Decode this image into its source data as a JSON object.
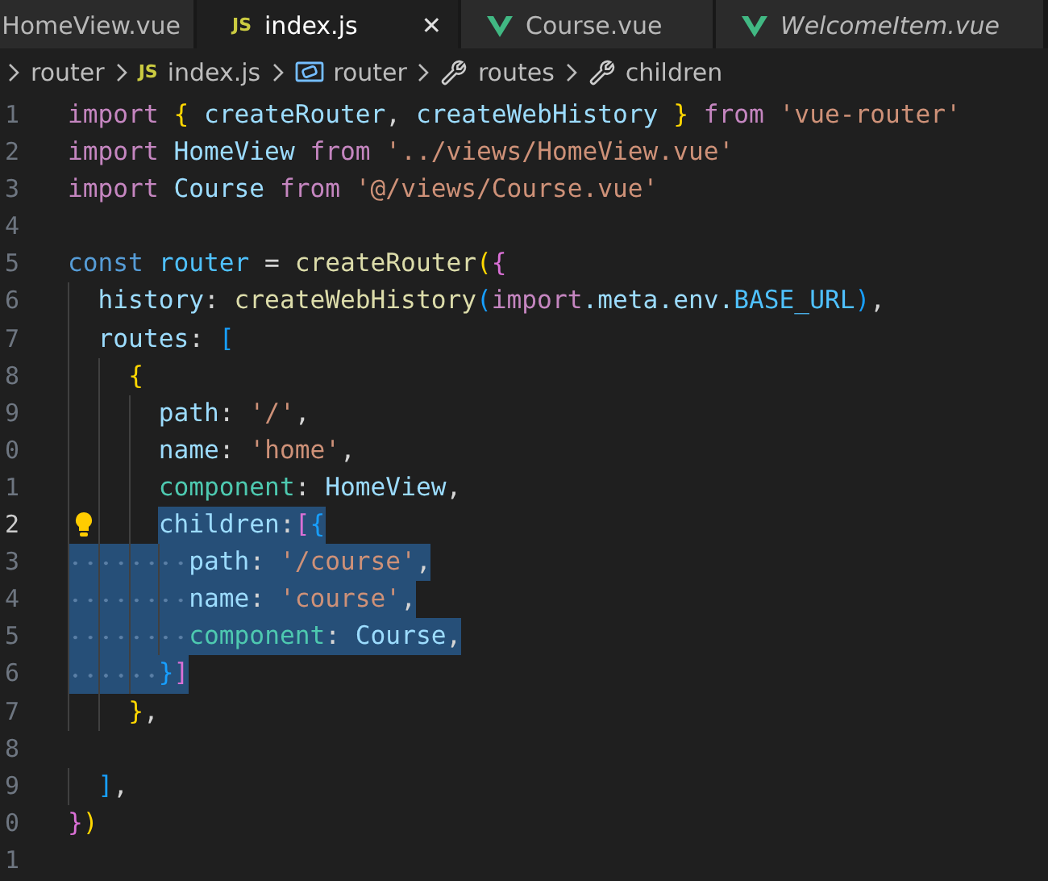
{
  "tabs": [
    {
      "label": "HomeView.vue",
      "selected": false,
      "preview": false,
      "kind": "plain"
    },
    {
      "label": "index.js",
      "selected": true,
      "preview": false,
      "kind": "js",
      "badge": "JS",
      "close": "✕"
    },
    {
      "label": "Course.vue",
      "selected": false,
      "preview": false,
      "kind": "vue"
    },
    {
      "label": "WelcomeItem.vue",
      "selected": false,
      "preview": true,
      "kind": "vue"
    }
  ],
  "breadcrumbs": [
    {
      "label": "router",
      "kind": "folder"
    },
    {
      "label": "index.js",
      "kind": "js",
      "badge": "JS"
    },
    {
      "label": "router",
      "kind": "variable"
    },
    {
      "label": "routes",
      "kind": "property"
    },
    {
      "label": "children",
      "kind": "property"
    }
  ],
  "lines": [
    {
      "number": "1",
      "current": false,
      "lightbulb": false,
      "selected": false,
      "tokens": [
        {
          "t": "import ",
          "kind": "kw"
        },
        {
          "t": "{",
          "kind": "b1"
        },
        {
          "t": " createRouter",
          "kind": "var"
        },
        {
          "t": ", ",
          "kind": "plain"
        },
        {
          "t": "createWebHistory ",
          "kind": "var"
        },
        {
          "t": "}",
          "kind": "b1"
        },
        {
          "t": " from",
          "kind": "kw"
        },
        {
          "t": " 'vue-router'",
          "kind": "str"
        }
      ]
    },
    {
      "number": "2",
      "current": false,
      "lightbulb": false,
      "selected": false,
      "tokens": [
        {
          "t": "import",
          "kind": "kw"
        },
        {
          "t": " HomeView ",
          "kind": "var"
        },
        {
          "t": "from",
          "kind": "kw"
        },
        {
          "t": " '../views/HomeView.vue'",
          "kind": "str"
        }
      ]
    },
    {
      "number": "3",
      "current": false,
      "lightbulb": false,
      "selected": false,
      "tokens": [
        {
          "t": "import",
          "kind": "kw"
        },
        {
          "t": " Course ",
          "kind": "var"
        },
        {
          "t": "from",
          "kind": "kw"
        },
        {
          "t": " '@/views/Course.vue'",
          "kind": "str"
        }
      ]
    },
    {
      "number": "4",
      "current": false,
      "lightbulb": false
    },
    {
      "number": "5",
      "current": false,
      "lightbulb": false,
      "selected": false,
      "tokens": [
        {
          "t": "const",
          "kind": "storage"
        },
        {
          "t": " router",
          "kind": "const"
        },
        {
          "t": " = ",
          "kind": "plain"
        },
        {
          "t": "createRouter",
          "kind": "fn"
        },
        {
          "t": "(",
          "kind": "b1"
        },
        {
          "t": "{",
          "kind": "b2"
        }
      ]
    },
    {
      "number": "6",
      "current": false,
      "lightbulb": false,
      "selected": false,
      "indent_selected": false,
      "tokens": [
        {
          "t": "  history",
          "kind": "prop"
        },
        {
          "t": ": ",
          "kind": "plain"
        },
        {
          "t": "createWebHistory",
          "kind": "fn"
        },
        {
          "t": "(",
          "kind": "b3"
        },
        {
          "t": "import",
          "kind": "kw"
        },
        {
          "t": ".meta.env.",
          "kind": "prop"
        },
        {
          "t": "BASE_URL",
          "kind": "const"
        },
        {
          "t": ")",
          "kind": "b3"
        },
        {
          "t": ",",
          "kind": "plain"
        }
      ]
    },
    {
      "number": "7",
      "current": false,
      "lightbulb": false,
      "selected": false,
      "indent_selected": false,
      "tokens": [
        {
          "t": "  routes",
          "kind": "prop"
        },
        {
          "t": ": ",
          "kind": "plain"
        },
        {
          "t": "[",
          "kind": "b3"
        }
      ]
    },
    {
      "number": "8",
      "current": false,
      "lightbulb": false,
      "selected": false,
      "indent_selected": false,
      "tokens": [
        {
          "t": "    {",
          "kind": "b1"
        }
      ]
    },
    {
      "number": "9",
      "current": false,
      "lightbulb": false,
      "selected": false,
      "indent_selected": false,
      "tokens": [
        {
          "t": "      path",
          "kind": "prop"
        },
        {
          "t": ": ",
          "kind": "plain"
        },
        {
          "t": "'/'",
          "kind": "str"
        },
        {
          "t": ",",
          "kind": "plain"
        }
      ]
    },
    {
      "number": "0",
      "current": false,
      "lightbulb": false,
      "selected": false,
      "indent_selected": false,
      "tokens": [
        {
          "t": "      name",
          "kind": "prop"
        },
        {
          "t": ": ",
          "kind": "plain"
        },
        {
          "t": "'home'",
          "kind": "str"
        },
        {
          "t": ",",
          "kind": "plain"
        }
      ]
    },
    {
      "number": "1",
      "current": false,
      "lightbulb": false,
      "selected": false,
      "indent_selected": false,
      "tokens": [
        {
          "t": "      component",
          "kind": "type"
        },
        {
          "t": ": ",
          "kind": "plain"
        },
        {
          "t": "HomeView",
          "kind": "var"
        },
        {
          "t": ",",
          "kind": "plain"
        }
      ]
    },
    {
      "number": "2",
      "current": true,
      "lightbulb": true,
      "selected": true,
      "indent_selected": false,
      "tokens": [
        {
          "t": "      children",
          "kind": "prop"
        },
        {
          "t": ":",
          "kind": "plain"
        },
        {
          "t": "[",
          "kind": "b2"
        },
        {
          "t": "{",
          "kind": "b3"
        }
      ]
    },
    {
      "number": "3",
      "current": false,
      "lightbulb": false,
      "selected": true,
      "indent_selected": true,
      "tokens": [
        {
          "t": "        path",
          "kind": "prop"
        },
        {
          "t": ": ",
          "kind": "plain"
        },
        {
          "t": "'/course'",
          "kind": "str"
        },
        {
          "t": ",",
          "kind": "plain"
        }
      ]
    },
    {
      "number": "4",
      "current": false,
      "lightbulb": false,
      "selected": true,
      "indent_selected": true,
      "tokens": [
        {
          "t": "        name",
          "kind": "prop"
        },
        {
          "t": ": ",
          "kind": "plain"
        },
        {
          "t": "'course'",
          "kind": "str"
        },
        {
          "t": ",",
          "kind": "plain"
        }
      ]
    },
    {
      "number": "5",
      "current": false,
      "lightbulb": false,
      "selected": true,
      "indent_selected": true,
      "tokens": [
        {
          "t": "        component",
          "kind": "type"
        },
        {
          "t": ": ",
          "kind": "plain"
        },
        {
          "t": "Course",
          "kind": "var"
        },
        {
          "t": ",",
          "kind": "plain"
        }
      ]
    },
    {
      "number": "6",
      "current": false,
      "lightbulb": false,
      "selected": true,
      "indent_selected": true,
      "tokens": [
        {
          "t": "      }",
          "kind": "b3"
        },
        {
          "t": "]",
          "kind": "b2"
        }
      ]
    },
    {
      "number": "7",
      "current": false,
      "lightbulb": false,
      "selected": false,
      "indent_selected": false,
      "tokens": [
        {
          "t": "    }",
          "kind": "b1"
        },
        {
          "t": ",",
          "kind": "plain"
        }
      ]
    },
    {
      "number": "8",
      "current": false,
      "lightbulb": false
    },
    {
      "number": "9",
      "current": false,
      "lightbulb": false,
      "selected": false,
      "indent_selected": false,
      "tokens": [
        {
          "t": "  ]",
          "kind": "b3"
        },
        {
          "t": ",",
          "kind": "plain"
        }
      ]
    },
    {
      "number": "0",
      "current": false,
      "lightbulb": false,
      "selected": false,
      "tokens": [
        {
          "t": "}",
          "kind": "b2"
        },
        {
          "t": ")",
          "kind": "b1"
        }
      ]
    },
    {
      "number": "1",
      "current": false,
      "lightbulb": false
    }
  ]
}
